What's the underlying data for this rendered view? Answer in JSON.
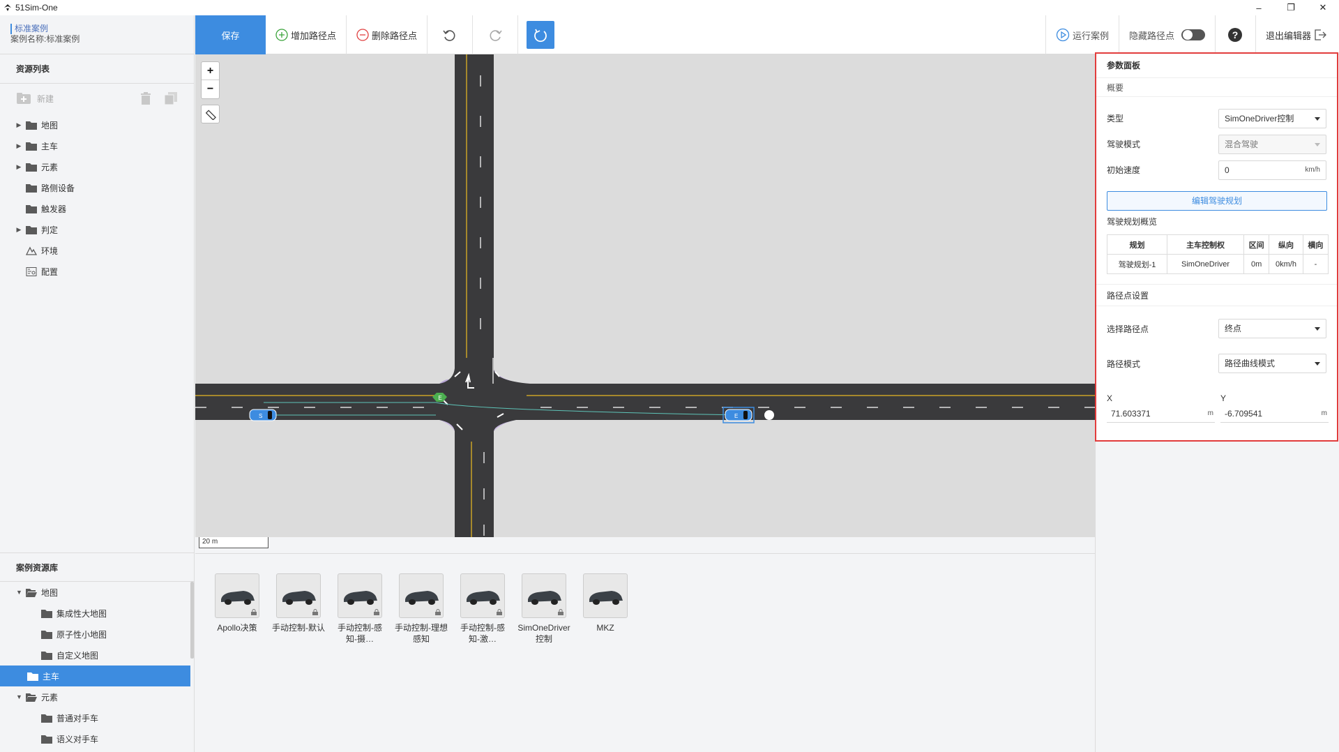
{
  "window": {
    "title": "51Sim-One",
    "minimize": "–",
    "restore": "❐",
    "close": "✕"
  },
  "case": {
    "type_label": "标准案例",
    "name_label": "案例名称:标准案例"
  },
  "resources": {
    "title": "资源列表",
    "new_label": "新建",
    "items": [
      {
        "label": "地图",
        "expandable": true
      },
      {
        "label": "主车",
        "expandable": true
      },
      {
        "label": "元素",
        "expandable": true
      },
      {
        "label": "路侧设备",
        "expandable": false
      },
      {
        "label": "触发器",
        "expandable": false
      },
      {
        "label": "判定",
        "expandable": true
      },
      {
        "label": "环境",
        "expandable": false
      },
      {
        "label": "配置",
        "expandable": false
      }
    ]
  },
  "library": {
    "title": "案例资源库",
    "items": [
      {
        "label": "地图",
        "level": 0
      },
      {
        "label": "集成性大地图",
        "level": 1
      },
      {
        "label": "原子性小地图",
        "level": 1
      },
      {
        "label": "自定义地图",
        "level": 1
      },
      {
        "label": "主车",
        "level": 0,
        "selected": true
      },
      {
        "label": "元素",
        "level": 0
      },
      {
        "label": "普通对手车",
        "level": 1
      },
      {
        "label": "语义对手车",
        "level": 1
      }
    ]
  },
  "toolbar": {
    "save": "保存",
    "add_waypoint": "增加路径点",
    "delete_waypoint": "删除路径点",
    "run_case": "运行案例",
    "hide_waypoints": "隐藏路径点",
    "exit_editor": "退出编辑器"
  },
  "map": {
    "zoom_in": "+",
    "zoom_out": "−",
    "scale_label": "20 m",
    "start_marker": "E",
    "end_marker": "E",
    "s_marker": "S"
  },
  "vehicles": [
    {
      "label": "Apollo决策",
      "locked": true
    },
    {
      "label": "手动控制-默认",
      "locked": true
    },
    {
      "label": "手动控制-感知-摄…",
      "locked": true
    },
    {
      "label": "手动控制-理想感知",
      "locked": true
    },
    {
      "label": "手动控制-感知-激…",
      "locked": true
    },
    {
      "label": "SimOneDriver控制",
      "locked": true
    },
    {
      "label": "MKZ",
      "locked": false
    }
  ],
  "panel": {
    "title": "参数面板",
    "overview": "概要",
    "type_label": "类型",
    "type_value": "SimOneDriver控制",
    "drive_mode_label": "驾驶模式",
    "drive_mode_value": "混合驾驶",
    "init_speed_label": "初始速度",
    "init_speed_value": "0",
    "init_speed_unit": "km/h",
    "edit_plan_button": "编辑驾驶规划",
    "plan_overview": "驾驶规划概览",
    "plan_headers": [
      "规划",
      "主车控制权",
      "区间",
      "纵向",
      "横向"
    ],
    "plan_rows": [
      [
        "驾驶规划-1",
        "SimOneDriver",
        "0m",
        "0km/h",
        "-"
      ]
    ],
    "route_settings": "路径点设置",
    "select_waypoint_label": "选择路径点",
    "select_waypoint_value": "终点",
    "route_mode_label": "路径模式",
    "route_mode_value": "路径曲线模式",
    "x_label": "X",
    "x_value": "71.603371",
    "x_unit": "m",
    "y_label": "Y",
    "y_value": "-6.709541",
    "y_unit": "m"
  },
  "colors": {
    "accent": "#3d8ce0",
    "highlight": "#e23c3c",
    "road": "#3a3a3c",
    "lane_yellow": "#c9a227"
  }
}
